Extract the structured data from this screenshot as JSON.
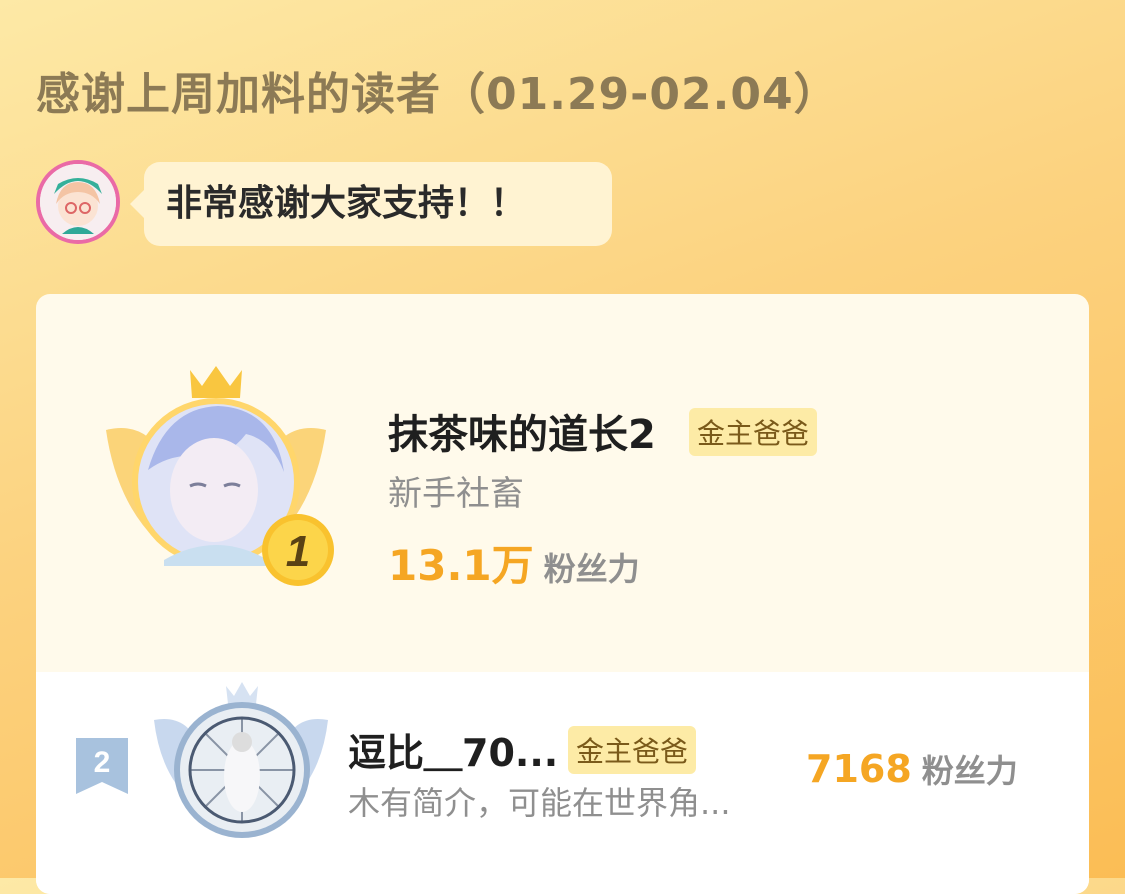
{
  "header": {
    "title": "感谢上周加料的读者（01.29-02.04）"
  },
  "author_message": {
    "text": "非常感谢大家支持！！"
  },
  "leaderboard": [
    {
      "rank": "1",
      "name": "抹茶味的道长2",
      "tag": "金主爸爸",
      "description": "新手社畜",
      "score": "13.1万",
      "score_unit": "粉丝力"
    },
    {
      "rank": "2",
      "name": "逗比＿70...",
      "tag": "金主爸爸",
      "description": "木有简介，可能在世界角...",
      "score": "7168",
      "score_unit": "粉丝力"
    }
  ],
  "colors": {
    "accent_orange": "#f5a623",
    "tag_bg": "#fdeba6",
    "title_color": "#8c7a55"
  }
}
